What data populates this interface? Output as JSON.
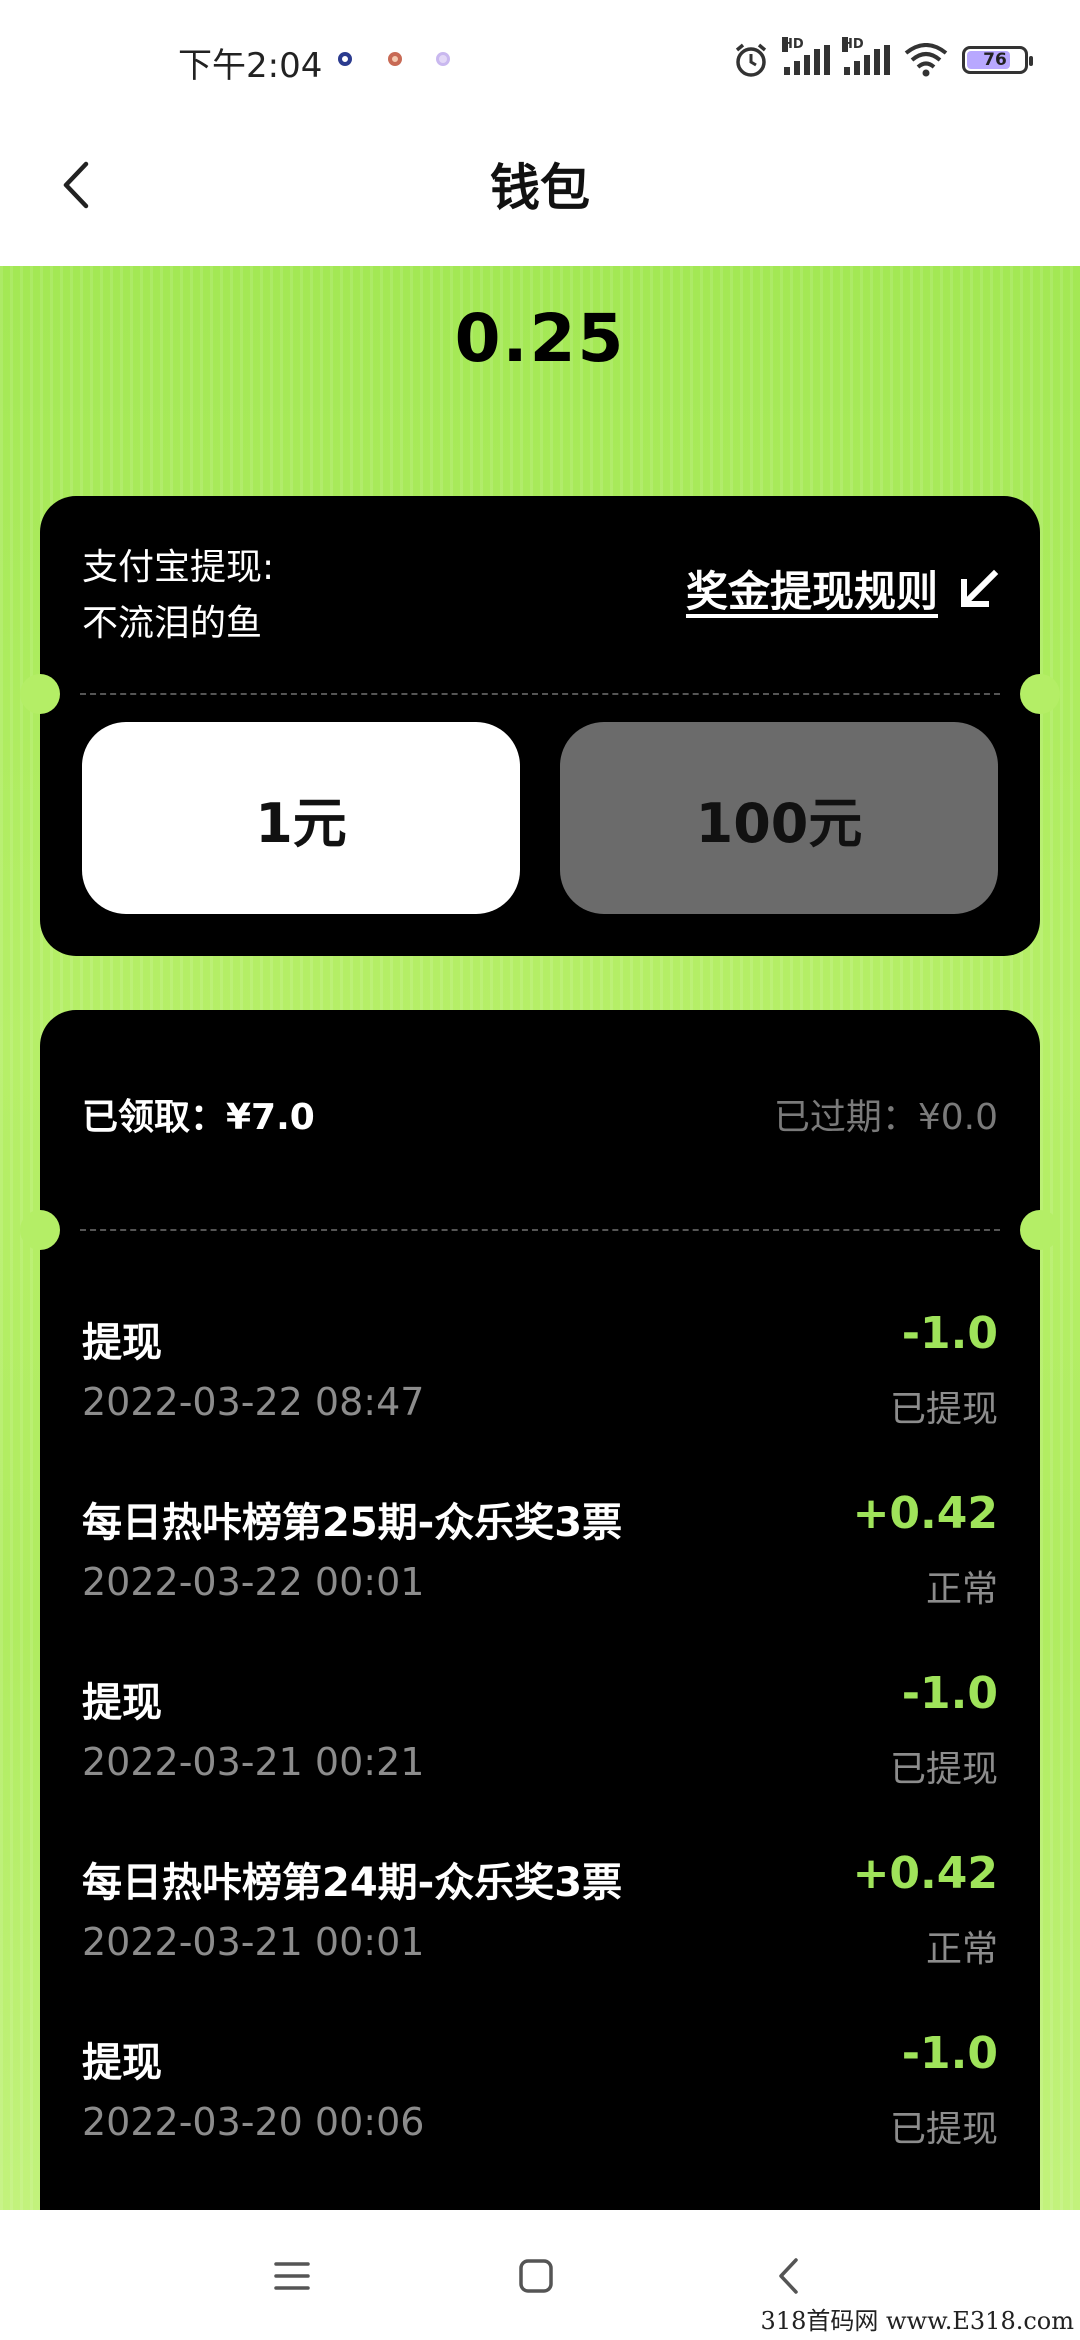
{
  "status_bar": {
    "time": "下午2:04",
    "battery": "76",
    "hd1": "HD",
    "hd2": "HD",
    "icons": [
      "alarm-icon",
      "signal-icon",
      "signal-icon",
      "wifi-icon",
      "battery-icon"
    ],
    "battery_level_percent": 76
  },
  "header": {
    "title": "钱包",
    "back_icon": "chevron-left-icon"
  },
  "balance": "0.25",
  "withdraw": {
    "label_line1": "支付宝提现:",
    "label_line2": "不流泪的鱼",
    "rules_link": "奖金提现规则",
    "rules_icon": "arrow-down-left-icon",
    "options": [
      "1元",
      "100元"
    ],
    "selected_option": "1元"
  },
  "summary": {
    "claimed": "已领取：¥7.0",
    "expired": "已过期：¥0.0"
  },
  "records": [
    {
      "title": "提现",
      "date": "2022-03-22 08:47",
      "amount": "-1.0",
      "status": "已提现"
    },
    {
      "title": "每日热咔榜第25期-众乐奖3票",
      "date": "2022-03-22 00:01",
      "amount": "+0.42",
      "status": "正常"
    },
    {
      "title": "提现",
      "date": "2022-03-21 00:21",
      "amount": "-1.0",
      "status": "已提现"
    },
    {
      "title": "每日热咔榜第24期-众乐奖3票",
      "date": "2022-03-21 00:01",
      "amount": "+0.42",
      "status": "正常"
    },
    {
      "title": "提现",
      "date": "2022-03-20 00:06",
      "amount": "-1.0",
      "status": "已提现"
    }
  ],
  "nav": {
    "icons": [
      "menu-icon",
      "home-square-icon",
      "back-icon"
    ]
  },
  "watermark": "318首码网 www.E318.com",
  "colors": {
    "accent_green": "#9fe35a",
    "background_green": "#b0ec60",
    "card_black": "#000000"
  }
}
